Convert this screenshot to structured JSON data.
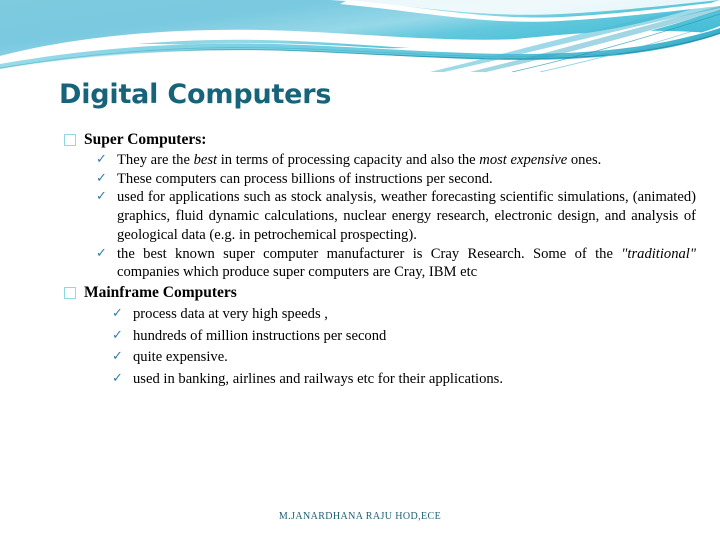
{
  "slide": {
    "title": "Digital Computers",
    "footer": "M.JANARDHANA RAJU HOD,ECE",
    "theme": {
      "title_color": "#17647a",
      "banner_light": "#7fcbe0",
      "banner_mid": "#5ec9dd",
      "banner_accent": "#2aa7bf",
      "square_bullet_color": "#8fd9e2",
      "check_bullet_color": "#2e7fa8",
      "body_text_color": "#000000",
      "background": "#ffffff"
    },
    "bullet_glyphs": {
      "level1": "square-outline",
      "level2": "check"
    },
    "sections": [
      {
        "heading": "Super Computers:",
        "items": [
          {
            "runs": [
              {
                "text": "They are the ",
                "italic": false
              },
              {
                "text": "best",
                "italic": true
              },
              {
                "text": " in terms of processing capacity and also the ",
                "italic": false
              },
              {
                "text": "most expensive",
                "italic": true
              },
              {
                "text": " ones.",
                "italic": false
              }
            ]
          },
          {
            "runs": [
              {
                "text": "These computers can process billions of instructions per second.",
                "italic": false
              }
            ]
          },
          {
            "runs": [
              {
                "text": "used for applications such as stock analysis, weather forecasting scientific simulations, (animated) graphics, fluid dynamic calculations, nuclear energy research, electronic design, and analysis of geological data (e.g. in petrochemical prospecting).",
                "italic": false
              }
            ]
          },
          {
            "runs": [
              {
                "text": "the best known super computer manufacturer is Cray Research. Some of the ",
                "italic": false
              },
              {
                "text": "\"traditional\"",
                "italic": true
              },
              {
                "text": " companies which produce super computers are Cray, IBM etc",
                "italic": false
              }
            ]
          }
        ]
      },
      {
        "heading": "Mainframe Computers",
        "items": [
          {
            "runs": [
              {
                "text": "process data at very high speeds ,",
                "italic": false
              }
            ]
          },
          {
            "runs": [
              {
                "text": "hundreds of million instructions per second",
                "italic": false
              }
            ]
          },
          {
            "runs": [
              {
                "text": "quite expensive.",
                "italic": false
              }
            ]
          },
          {
            "runs": [
              {
                "text": "used in banking, airlines and railways etc for their applications.",
                "italic": false
              }
            ]
          }
        ]
      }
    ]
  }
}
